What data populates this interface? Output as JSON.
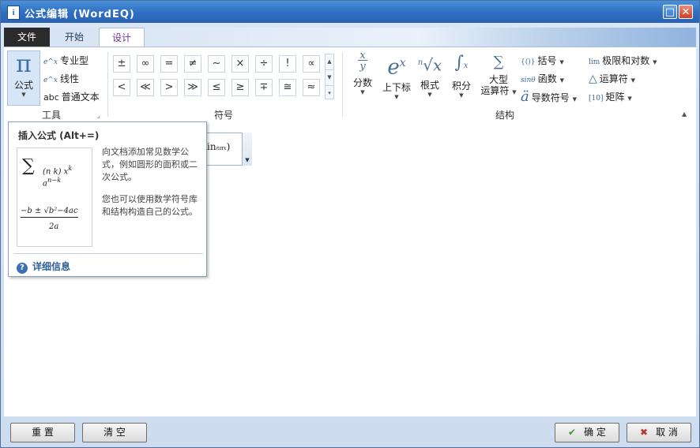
{
  "window": {
    "title": "公式编辑 (WordEQ)"
  },
  "tabs": [
    {
      "label": "文件"
    },
    {
      "label": "开始"
    },
    {
      "label": "设计"
    }
  ],
  "tools_group": {
    "label": "工具",
    "formula_button": "公式",
    "formula_glyph": "π",
    "professional": "专业型",
    "linear": "线性",
    "plain_text": "普通文本",
    "plain_text_icon": "abc"
  },
  "symbols_group": {
    "label": "符号",
    "row1": [
      "±",
      "∞",
      "=",
      "≠",
      "~",
      "×",
      "÷",
      "!",
      "∝"
    ],
    "row2": [
      "<",
      "≪",
      ">",
      "≫",
      "≤",
      "≥",
      "∓",
      "≅",
      "≈"
    ]
  },
  "structure_group": {
    "label": "结构",
    "fraction": "分数",
    "script": "上下标",
    "radical": "根式",
    "integral": "积分",
    "large_operator_1": "大型",
    "large_operator_2": "运算符",
    "bracket": "括号",
    "function": "函数",
    "accent": "导数符号",
    "limit_log": "极限和对数",
    "operator": "运算符",
    "matrix": "矩阵"
  },
  "tooltip": {
    "title": "插入公式 (Alt+=)",
    "desc1": "向文档添加常见数学公式，例如圆形的面积或二次公式。",
    "desc2": "您也可以使用数学符号库和结构构造自己的公式。",
    "help": "详细信息"
  },
  "footer": {
    "reset": "重 置",
    "clear": "清 空",
    "ok": "确 定",
    "cancel": "取 消"
  }
}
